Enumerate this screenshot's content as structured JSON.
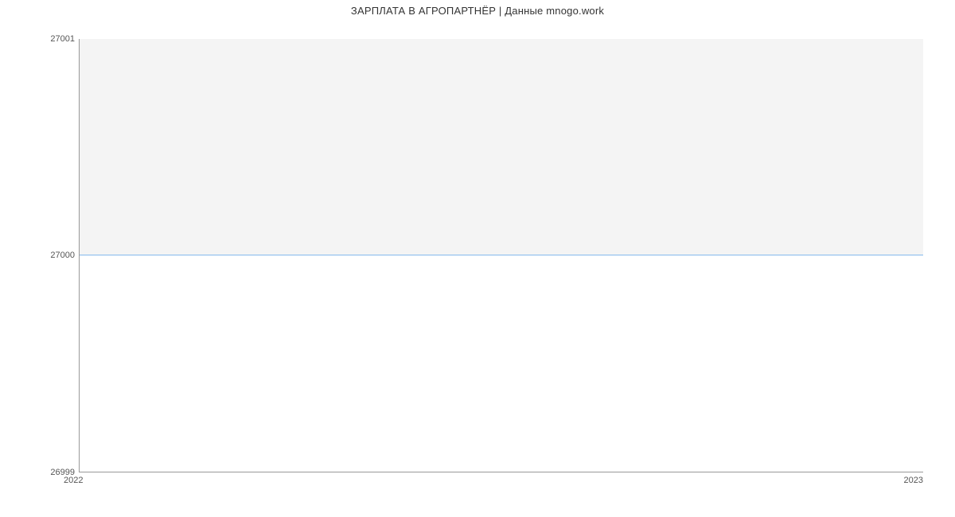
{
  "chart_data": {
    "type": "line",
    "title": "ЗАРПЛАТА В  АГРОПАРТНЁР | Данные mnogo.work",
    "xlabel": "",
    "ylabel": "",
    "x": [
      2022,
      2023
    ],
    "values": [
      27000,
      27000
    ],
    "x_ticks": [
      "2022",
      "2023"
    ],
    "y_ticks": [
      "26999",
      "27000",
      "27001"
    ],
    "ylim": [
      26999,
      27001
    ],
    "grid": false,
    "band": {
      "from": 27000,
      "to": 27001,
      "color": "#f4f4f4"
    },
    "line_color": "#7cb5ec"
  }
}
